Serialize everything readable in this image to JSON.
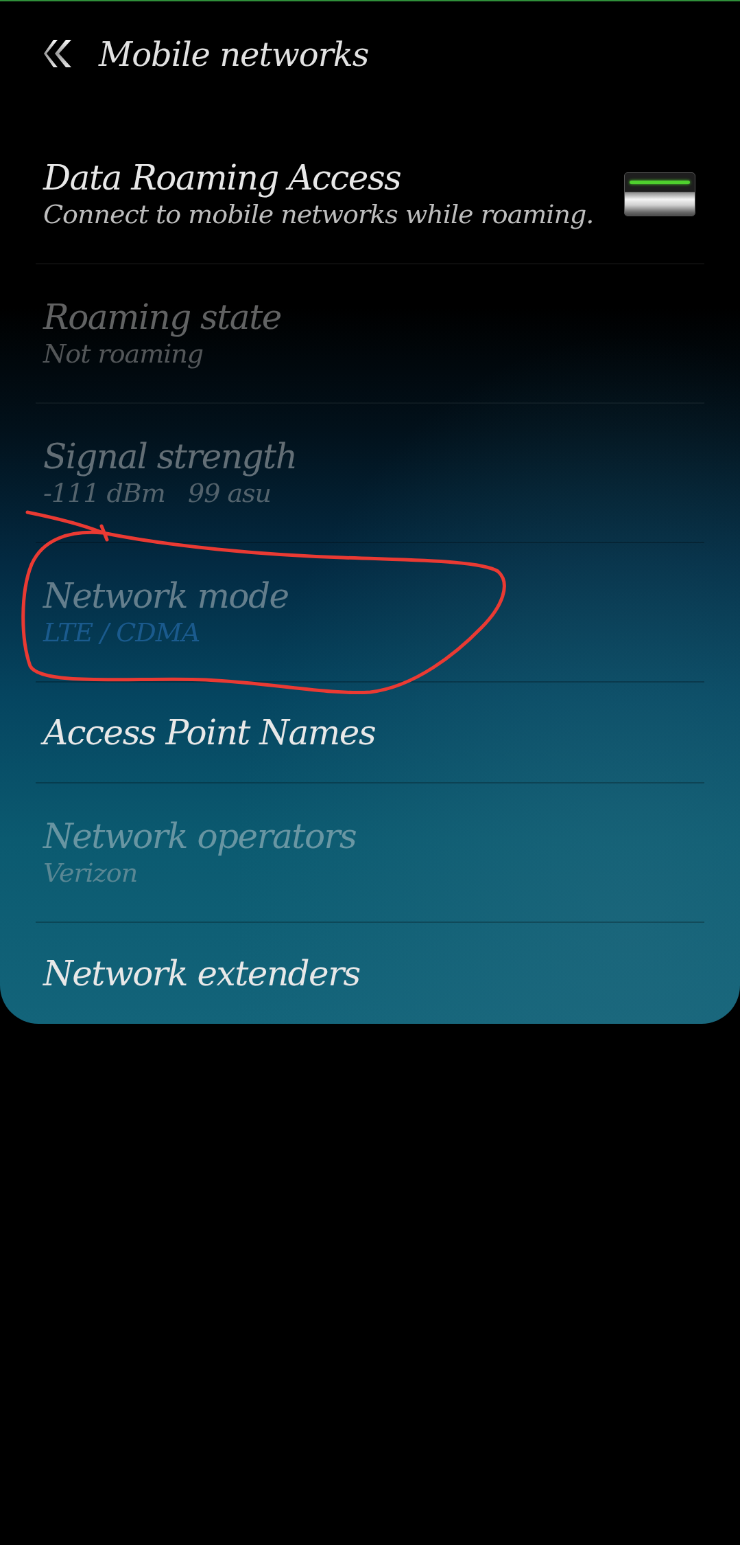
{
  "header": {
    "title": "Mobile networks"
  },
  "items": [
    {
      "kind": "switch",
      "title": "Data Roaming Access",
      "summary": "Connect to mobile networks while roaming.",
      "disabled": false,
      "on": true
    },
    {
      "kind": "info",
      "title": "Roaming state",
      "summary": "Not roaming",
      "disabled": true
    },
    {
      "kind": "info",
      "title": "Signal strength",
      "summary": "-111 dBm   99 asu",
      "disabled": true
    },
    {
      "kind": "list",
      "title": "Network mode",
      "summary": "LTE / CDMA",
      "disabled": true
    },
    {
      "kind": "link",
      "title": "Access Point Names",
      "disabled": false
    },
    {
      "kind": "info",
      "title": "Network operators",
      "summary": "Verizon",
      "disabled": true
    },
    {
      "kind": "link",
      "title": "Network extenders",
      "disabled": false
    }
  ]
}
